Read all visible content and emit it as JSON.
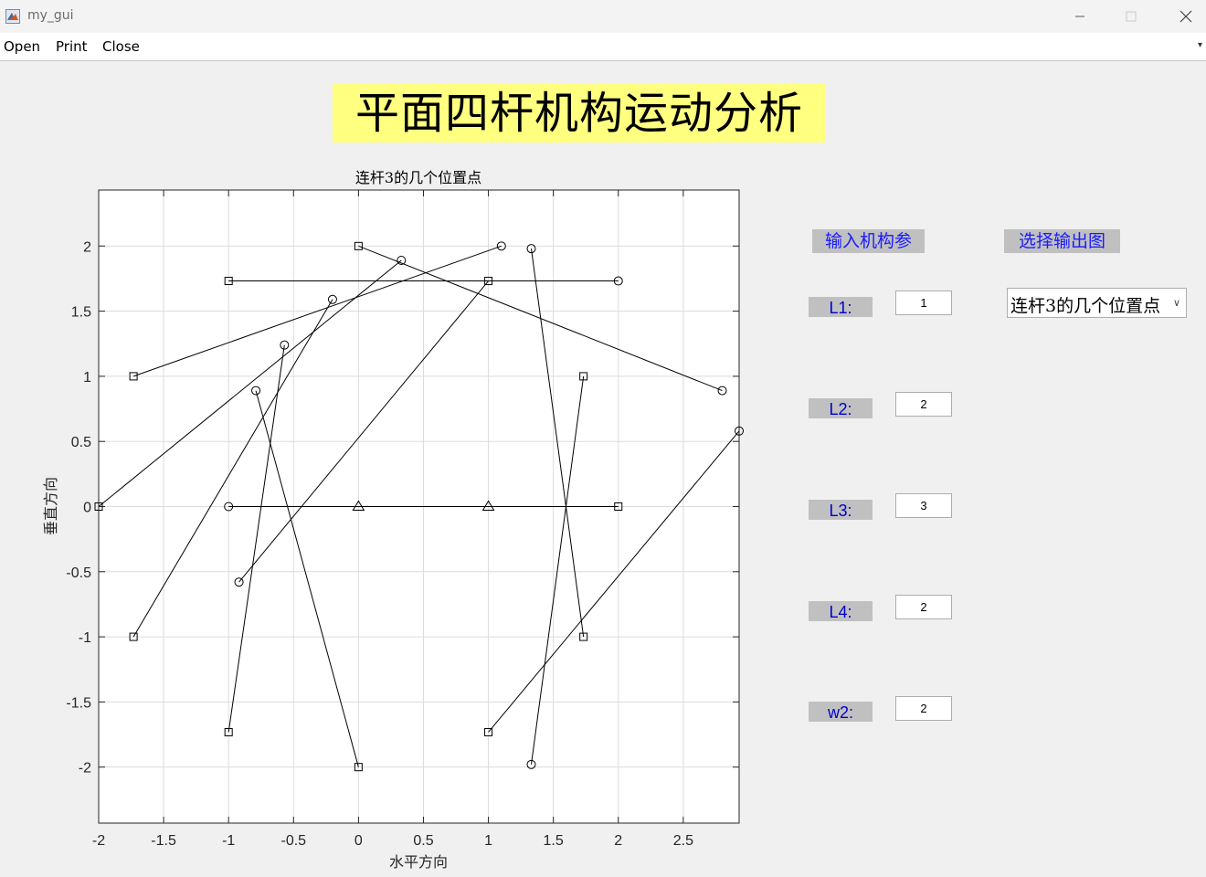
{
  "window": {
    "title": "my_gui"
  },
  "menu": {
    "items": [
      "Open",
      "Print",
      "Close"
    ]
  },
  "header": {
    "title": "平面四杆机构运动分析"
  },
  "panel": {
    "input_header": "输入机构参",
    "output_header": "选择输出图",
    "params": [
      {
        "label": "L1:",
        "value": "1"
      },
      {
        "label": "L2:",
        "value": "2"
      },
      {
        "label": "L3:",
        "value": "3"
      },
      {
        "label": "L4:",
        "value": "2"
      },
      {
        "label": "w2:",
        "value": "2"
      }
    ],
    "output_select": {
      "selected": "连杆3的几个位置点"
    }
  },
  "chart_data": {
    "type": "line",
    "title": "连杆3的几个位置点",
    "xlabel": "水平方向",
    "ylabel": "垂直方向",
    "xlim": [
      -2,
      2.93
    ],
    "ylim": [
      -2.43,
      2.43
    ],
    "xticks": [
      -2,
      -1.5,
      -1,
      -0.5,
      0,
      0.5,
      1,
      1.5,
      2,
      2.5
    ],
    "yticks": [
      -2,
      -1.5,
      -1,
      -0.5,
      0,
      0.5,
      1,
      1.5,
      2
    ],
    "xtick_labels": [
      "-2",
      "-1.5",
      "-1",
      "-0.5",
      "0",
      "0.5",
      "1",
      "1.5",
      "2",
      "2.5"
    ],
    "ytick_labels": [
      "-2",
      "-1.5",
      "-1",
      "-0.5",
      "0",
      "0.5",
      "1",
      "1.5",
      "2"
    ],
    "grid": true,
    "segments": [
      {
        "p1": [
          -1,
          0
        ],
        "p2": [
          2,
          0
        ],
        "m1": "circle",
        "m2": "square"
      },
      {
        "p1": [
          -1,
          1.732
        ],
        "p2": [
          2,
          1.732
        ],
        "m1": "square",
        "m2": "circle"
      },
      {
        "p1": [
          0,
          2
        ],
        "p2": [
          2.8,
          0.89
        ],
        "m1": "square",
        "m2": "circle"
      },
      {
        "p1": [
          -1.732,
          1
        ],
        "p2": [
          1.1,
          2
        ],
        "m1": "square",
        "m2": "circle"
      },
      {
        "p1": [
          -2,
          0
        ],
        "p2": [
          0.33,
          1.89
        ],
        "m1": "square",
        "m2": "circle"
      },
      {
        "p1": [
          -1.732,
          -1
        ],
        "p2": [
          -0.2,
          1.59
        ],
        "m1": "square",
        "m2": "circle"
      },
      {
        "p1": [
          -1,
          -1.732
        ],
        "p2": [
          -0.57,
          1.24
        ],
        "m1": "square",
        "m2": "circle"
      },
      {
        "p1": [
          0,
          -2
        ],
        "p2": [
          -0.79,
          0.89
        ],
        "m1": "square",
        "m2": "circle"
      },
      {
        "p1": [
          1,
          1.732
        ],
        "p2": [
          -0.92,
          -0.58
        ],
        "m1": "square",
        "m2": "circle"
      },
      {
        "p1": [
          1,
          -1.732
        ],
        "p2": [
          2.93,
          0.58
        ],
        "m1": "square",
        "m2": "circle"
      },
      {
        "p1": [
          1.732,
          1
        ],
        "p2": [
          1.33,
          -1.98
        ],
        "m1": "square",
        "m2": "circle"
      },
      {
        "p1": [
          1.732,
          -1
        ],
        "p2": [
          1.33,
          1.98
        ],
        "m1": "square",
        "m2": "circle"
      }
    ],
    "triangles": [
      [
        0,
        0
      ],
      [
        1,
        0
      ]
    ]
  }
}
